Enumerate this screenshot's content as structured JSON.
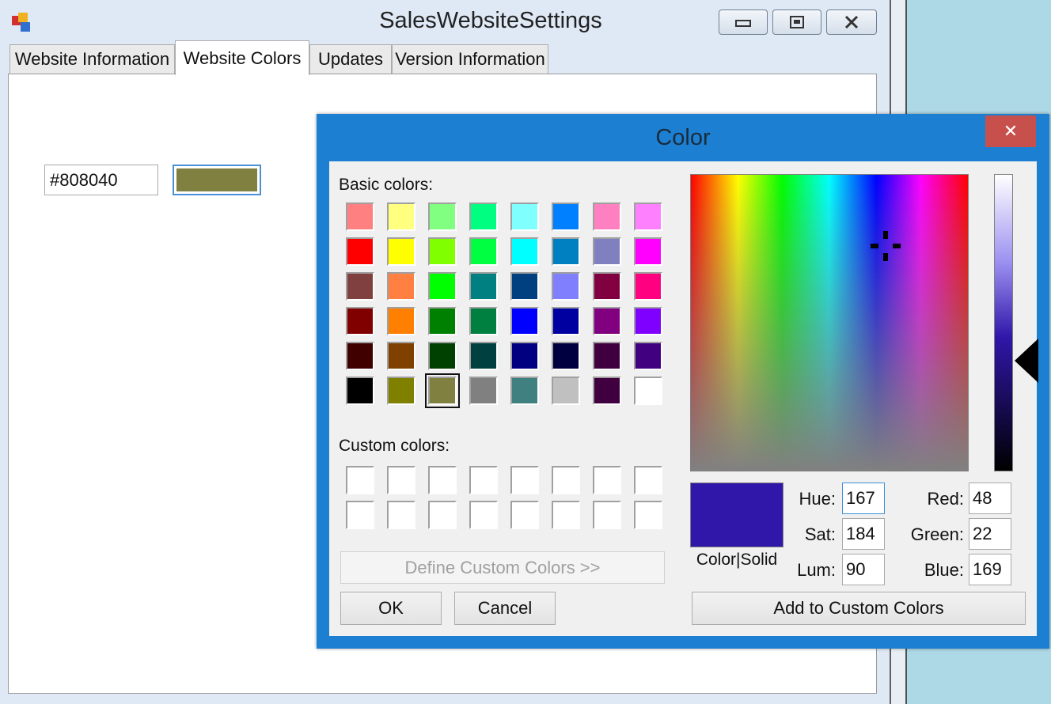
{
  "app": {
    "title": "SalesWebsiteSettings"
  },
  "tabs": [
    {
      "label": "Website Information"
    },
    {
      "label": "Website Colors"
    },
    {
      "label": "Updates"
    },
    {
      "label": "Version Information"
    }
  ],
  "page": {
    "hex_value": "#808040",
    "swatch_color": "#808040"
  },
  "dialog": {
    "title": "Color",
    "close_glyph": "✕",
    "basic_colors_label": "Basic colors:",
    "custom_colors_label": "Custom colors:",
    "basic_colors": [
      "#ff8080",
      "#ffff80",
      "#80ff80",
      "#00ff80",
      "#80ffff",
      "#0080ff",
      "#ff80c0",
      "#ff80ff",
      "#ff0000",
      "#ffff00",
      "#80ff00",
      "#00ff40",
      "#00ffff",
      "#0080c0",
      "#8080c0",
      "#ff00ff",
      "#804040",
      "#ff8040",
      "#00ff00",
      "#008080",
      "#004080",
      "#8080ff",
      "#800040",
      "#ff0080",
      "#800000",
      "#ff8000",
      "#008000",
      "#008040",
      "#0000ff",
      "#0000a0",
      "#800080",
      "#8000ff",
      "#400000",
      "#804000",
      "#004000",
      "#004040",
      "#000080",
      "#000040",
      "#400040",
      "#400080",
      "#000000",
      "#808000",
      "#808040",
      "#808080",
      "#408080",
      "#c0c0c0",
      "#400040",
      "#ffffff"
    ],
    "selected_basic_index": 42,
    "custom_colors": [
      "#ffffff",
      "#ffffff",
      "#ffffff",
      "#ffffff",
      "#ffffff",
      "#ffffff",
      "#ffffff",
      "#ffffff",
      "#ffffff",
      "#ffffff",
      "#ffffff",
      "#ffffff",
      "#ffffff",
      "#ffffff",
      "#ffffff",
      "#ffffff"
    ],
    "define_custom_label": "Define Custom Colors >>",
    "ok_label": "OK",
    "cancel_label": "Cancel",
    "add_custom_label": "Add to Custom Colors",
    "preview_label": "Color|Solid",
    "preview_color": "#3016a9",
    "hue_label": "Hue:",
    "hue": "167",
    "sat_label": "Sat:",
    "sat": "184",
    "lum_label": "Lum:",
    "lum": "90",
    "red_label": "Red:",
    "red": "48",
    "green_label": "Green:",
    "green": "22",
    "blue_label": "Blue:",
    "blue": "169"
  },
  "colors": {
    "dialog_frame": "#1d7fd1",
    "close_button": "#c8504c",
    "desktop": "#add8e6"
  }
}
